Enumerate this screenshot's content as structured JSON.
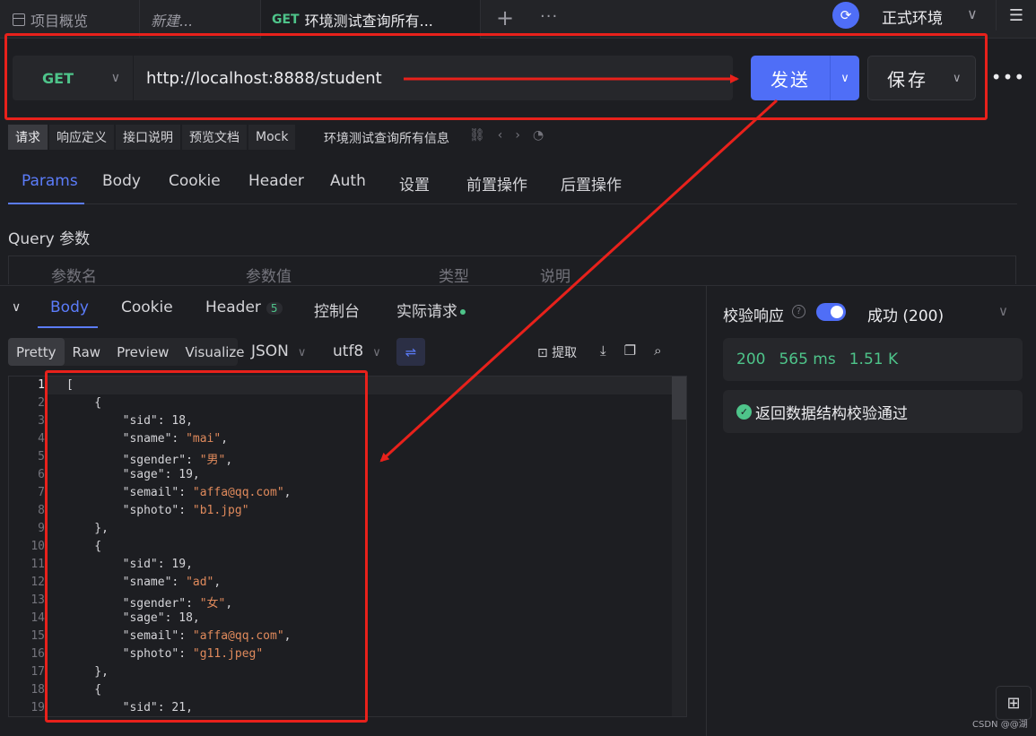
{
  "tabs": {
    "overview": "项目概览",
    "new_tab": "新建...",
    "active_method": "GET",
    "active_title": "环境测试查询所有...",
    "add": "+",
    "more": "···"
  },
  "env": {
    "label": "正式环境",
    "icon": "sync-icon"
  },
  "request": {
    "method": "GET",
    "url": "http://localhost:8888/student",
    "send_label": "发送",
    "save_label": "保存",
    "more": "•••"
  },
  "doc_tabs": [
    "请求",
    "响应定义",
    "接口说明",
    "预览文档",
    "Mock"
  ],
  "doc_title": "环境测试查询所有信息",
  "request_tabs": [
    "Params",
    "Body",
    "Cookie",
    "Header",
    "Auth",
    "设置",
    "前置操作",
    "后置操作"
  ],
  "query": {
    "title": "Query 参数",
    "columns": [
      "参数名",
      "参数值",
      "类型",
      "说明"
    ]
  },
  "response": {
    "tabs": [
      "Body",
      "Cookie",
      "Header",
      "控制台",
      "实际请求"
    ],
    "header_count": "5",
    "view_modes": [
      "Pretty",
      "Raw",
      "Preview",
      "Visualize"
    ],
    "format": "JSON",
    "encoding": "utf8",
    "extract_label": "提取",
    "line_numbers": [
      "1",
      "2",
      "3",
      "4",
      "5",
      "6",
      "7",
      "8",
      "9",
      "10",
      "11",
      "12",
      "13",
      "14",
      "15",
      "16",
      "17",
      "18",
      "19"
    ],
    "lines": [
      [
        [
          "p",
          "["
        ]
      ],
      [
        [
          "p",
          "    {"
        ]
      ],
      [
        [
          "p",
          "        "
        ],
        [
          "k",
          "\"sid\""
        ],
        [
          "p",
          ": 18,"
        ]
      ],
      [
        [
          "p",
          "        "
        ],
        [
          "k",
          "\"sname\""
        ],
        [
          "p",
          ": "
        ],
        [
          "s",
          "\"mai\""
        ],
        [
          "p",
          ","
        ]
      ],
      [
        [
          "p",
          "        "
        ],
        [
          "k",
          "\"sgender\""
        ],
        [
          "p",
          ": "
        ],
        [
          "s",
          "\"男\""
        ],
        [
          "p",
          ","
        ]
      ],
      [
        [
          "p",
          "        "
        ],
        [
          "k",
          "\"sage\""
        ],
        [
          "p",
          ": 19,"
        ]
      ],
      [
        [
          "p",
          "        "
        ],
        [
          "k",
          "\"semail\""
        ],
        [
          "p",
          ": "
        ],
        [
          "s",
          "\"affa@qq.com\""
        ],
        [
          "p",
          ","
        ]
      ],
      [
        [
          "p",
          "        "
        ],
        [
          "k",
          "\"sphoto\""
        ],
        [
          "p",
          ": "
        ],
        [
          "s",
          "\"b1.jpg\""
        ]
      ],
      [
        [
          "p",
          "    },"
        ]
      ],
      [
        [
          "p",
          "    {"
        ]
      ],
      [
        [
          "p",
          "        "
        ],
        [
          "k",
          "\"sid\""
        ],
        [
          "p",
          ": 19,"
        ]
      ],
      [
        [
          "p",
          "        "
        ],
        [
          "k",
          "\"sname\""
        ],
        [
          "p",
          ": "
        ],
        [
          "s",
          "\"ad\""
        ],
        [
          "p",
          ","
        ]
      ],
      [
        [
          "p",
          "        "
        ],
        [
          "k",
          "\"sgender\""
        ],
        [
          "p",
          ": "
        ],
        [
          "s",
          "\"女\""
        ],
        [
          "p",
          ","
        ]
      ],
      [
        [
          "p",
          "        "
        ],
        [
          "k",
          "\"sage\""
        ],
        [
          "p",
          ": 18,"
        ]
      ],
      [
        [
          "p",
          "        "
        ],
        [
          "k",
          "\"semail\""
        ],
        [
          "p",
          ": "
        ],
        [
          "s",
          "\"affa@qq.com\""
        ],
        [
          "p",
          ","
        ]
      ],
      [
        [
          "p",
          "        "
        ],
        [
          "k",
          "\"sphoto\""
        ],
        [
          "p",
          ": "
        ],
        [
          "s",
          "\"g11.jpeg\""
        ]
      ],
      [
        [
          "p",
          "    },"
        ]
      ],
      [
        [
          "p",
          "    {"
        ]
      ],
      [
        [
          "p",
          "        "
        ],
        [
          "k",
          "\"sid\""
        ],
        [
          "p",
          ": 21,"
        ]
      ]
    ]
  },
  "validation": {
    "label": "校验响应",
    "help": "?",
    "status": "成功 (200)",
    "code": "200",
    "time": "565 ms",
    "size": "1.51 K",
    "result": "返回数据结构校验通过"
  },
  "watermark": "CSDN @@湖",
  "colors": {
    "accent": "#4f6ef7",
    "success": "#4ec48a",
    "string": "#e08a5c",
    "annotation": "#e8211b"
  }
}
